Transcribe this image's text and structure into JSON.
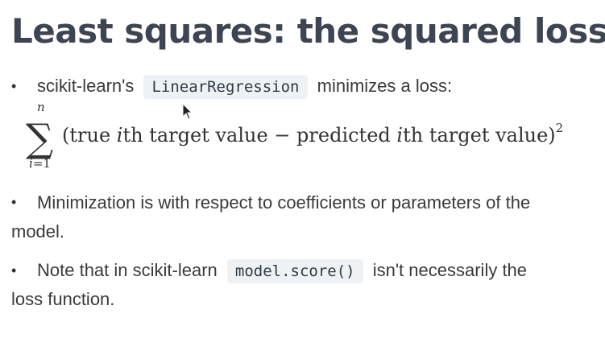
{
  "slide": {
    "title": "Least squares: the squared loss"
  },
  "bullets": [
    {
      "marker": "•",
      "text_before": "scikit-learn's",
      "code": "LinearRegression",
      "text_after": "minimizes a loss:"
    },
    {
      "marker": "•",
      "line1": "Minimization is with respect to coefficients or parameters of the",
      "line2": "model."
    },
    {
      "marker": "•",
      "text_before": "Note that in scikit-learn",
      "code": "model.score()",
      "text_after": "isn't necessarily the",
      "line2": "loss function."
    }
  ],
  "formula": {
    "sigma": "∑",
    "upper_limit": "n",
    "lower_limit_var": "i",
    "lower_limit_eq": "=1",
    "open_paren": "(true ",
    "index1": "i",
    "middle": "th target value − predicted ",
    "index2": "i",
    "end": "th target value)",
    "exponent": "2"
  },
  "icons": {
    "cursor": "mouse-pointer-icon"
  }
}
